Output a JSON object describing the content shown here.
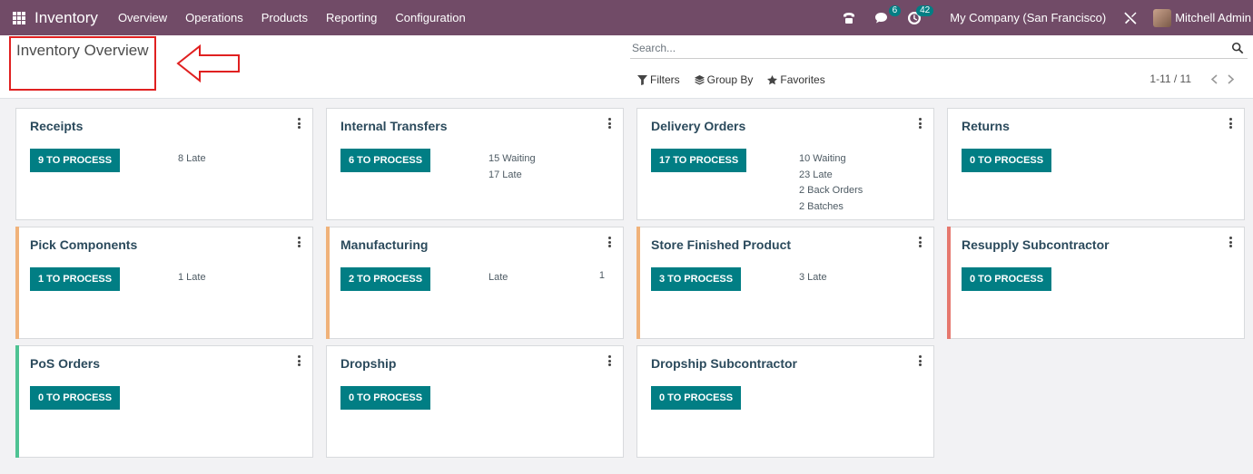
{
  "navbar": {
    "app_title": "Inventory",
    "menu": [
      "Overview",
      "Operations",
      "Products",
      "Reporting",
      "Configuration"
    ],
    "chat_badge": "6",
    "activity_badge": "42",
    "company": "My Company (San Francisco)",
    "user": "Mitchell Admin",
    "icons": [
      "apps-grid-icon",
      "phone-icon",
      "chat-icon",
      "clock-icon",
      "tools-icon"
    ]
  },
  "control_panel": {
    "title": "Inventory Overview",
    "search_placeholder": "Search...",
    "filters_label": "Filters",
    "group_by_label": "Group By",
    "favorites_label": "Favorites",
    "pager": "1-11 / 11",
    "annotation_color": "#e02020"
  },
  "colors": {
    "navbar": "#714b67",
    "primary_button": "#017e84",
    "accent_orange": "#f0b27a",
    "accent_red": "#e6786e",
    "accent_green": "#4fc393"
  },
  "cards": [
    {
      "title": "Receipts",
      "button": "9 TO PROCESS",
      "stats": [
        "8 Late"
      ],
      "count": "",
      "accent": ""
    },
    {
      "title": "Internal Transfers",
      "button": "6 TO PROCESS",
      "stats": [
        "15 Waiting",
        "17 Late"
      ],
      "count": "",
      "accent": ""
    },
    {
      "title": "Delivery Orders",
      "button": "17 TO PROCESS",
      "stats": [
        "10 Waiting",
        "23 Late",
        "2 Back Orders",
        "2 Batches"
      ],
      "count": "",
      "accent": ""
    },
    {
      "title": "Returns",
      "button": "0 TO PROCESS",
      "stats": [],
      "count": "",
      "accent": ""
    },
    {
      "title": "Pick Components",
      "button": "1 TO PROCESS",
      "stats": [
        "1 Late"
      ],
      "count": "",
      "accent": "#f0b27a"
    },
    {
      "title": "Manufacturing",
      "button": "2 TO PROCESS",
      "stats": [
        "Late"
      ],
      "count": "1",
      "accent": "#f0b27a"
    },
    {
      "title": "Store Finished Product",
      "button": "3 TO PROCESS",
      "stats": [
        "3 Late"
      ],
      "count": "",
      "accent": "#f0b27a"
    },
    {
      "title": "Resupply Subcontractor",
      "button": "0 TO PROCESS",
      "stats": [],
      "count": "",
      "accent": "#e6786e"
    },
    {
      "title": "PoS Orders",
      "button": "0 TO PROCESS",
      "stats": [],
      "count": "",
      "accent": "#4fc393"
    },
    {
      "title": "Dropship",
      "button": "0 TO PROCESS",
      "stats": [],
      "count": "",
      "accent": ""
    },
    {
      "title": "Dropship Subcontractor",
      "button": "0 TO PROCESS",
      "stats": [],
      "count": "",
      "accent": ""
    }
  ]
}
